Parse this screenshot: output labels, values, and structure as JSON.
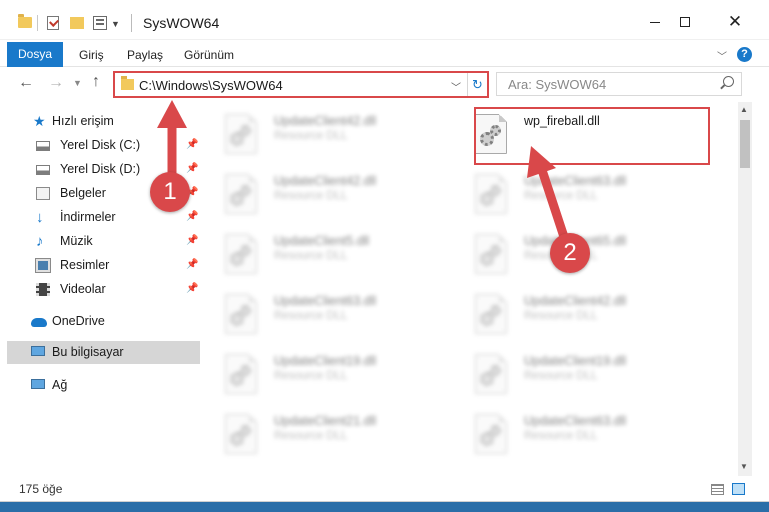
{
  "window": {
    "title": "SysWOW64"
  },
  "ribbon": {
    "tabs": [
      "Dosya",
      "Giriş",
      "Paylaş",
      "Görünüm"
    ]
  },
  "address": {
    "path": "C:\\Windows\\SysWOW64",
    "search_placeholder": "Ara: SysWOW64"
  },
  "sidebar": {
    "items": [
      {
        "label": "Hızlı erişim",
        "icon": "star-icon"
      },
      {
        "label": "Yerel Disk (C:)",
        "icon": "drive-icon",
        "pinned": true
      },
      {
        "label": "Yerel Disk (D:)",
        "icon": "drive-icon",
        "pinned": true
      },
      {
        "label": "Belgeler",
        "icon": "documents-icon",
        "pinned": true
      },
      {
        "label": "İndirmeler",
        "icon": "download-icon",
        "pinned": true
      },
      {
        "label": "Müzik",
        "icon": "music-icon",
        "pinned": true
      },
      {
        "label": "Resimler",
        "icon": "pictures-icon",
        "pinned": true
      },
      {
        "label": "Videolar",
        "icon": "videos-icon",
        "pinned": true
      },
      {
        "label": "OneDrive",
        "icon": "cloud-icon"
      },
      {
        "label": "Bu bilgisayar",
        "icon": "computer-icon",
        "selected": true
      },
      {
        "label": "Ağ",
        "icon": "network-icon"
      }
    ]
  },
  "files": {
    "left": [
      {
        "name": "UpdateClient42.dll",
        "type": "Resource DLL"
      },
      {
        "name": "UpdateClient42.dll",
        "type": "Resource DLL"
      },
      {
        "name": "UpdateClient5.dll",
        "type": "Resource DLL"
      },
      {
        "name": "UpdateClient63.dll",
        "type": "Resource DLL"
      },
      {
        "name": "UpdateClient19.dll",
        "type": "Resource DLL"
      },
      {
        "name": "UpdateClient21.dll",
        "type": "Resource DLL"
      }
    ],
    "right": [
      {
        "name": "wp_fireball.dll",
        "type": ""
      },
      {
        "name": "UpdateClient63.dll",
        "type": "Resource DLL"
      },
      {
        "name": "UpdateClient65.dll",
        "type": "Resource DLL"
      },
      {
        "name": "UpdateClient42.dll",
        "type": "Resource DLL"
      },
      {
        "name": "UpdateClient19.dll",
        "type": "Resource DLL"
      },
      {
        "name": "UpdateClient63.dll",
        "type": "Resource DLL"
      }
    ]
  },
  "status": {
    "count": "175 öğe"
  },
  "annotations": {
    "step1": "1",
    "step2": "2",
    "color": "#d9484a"
  },
  "colors": {
    "accent": "#1979ca",
    "highlight": "#d9484a"
  }
}
